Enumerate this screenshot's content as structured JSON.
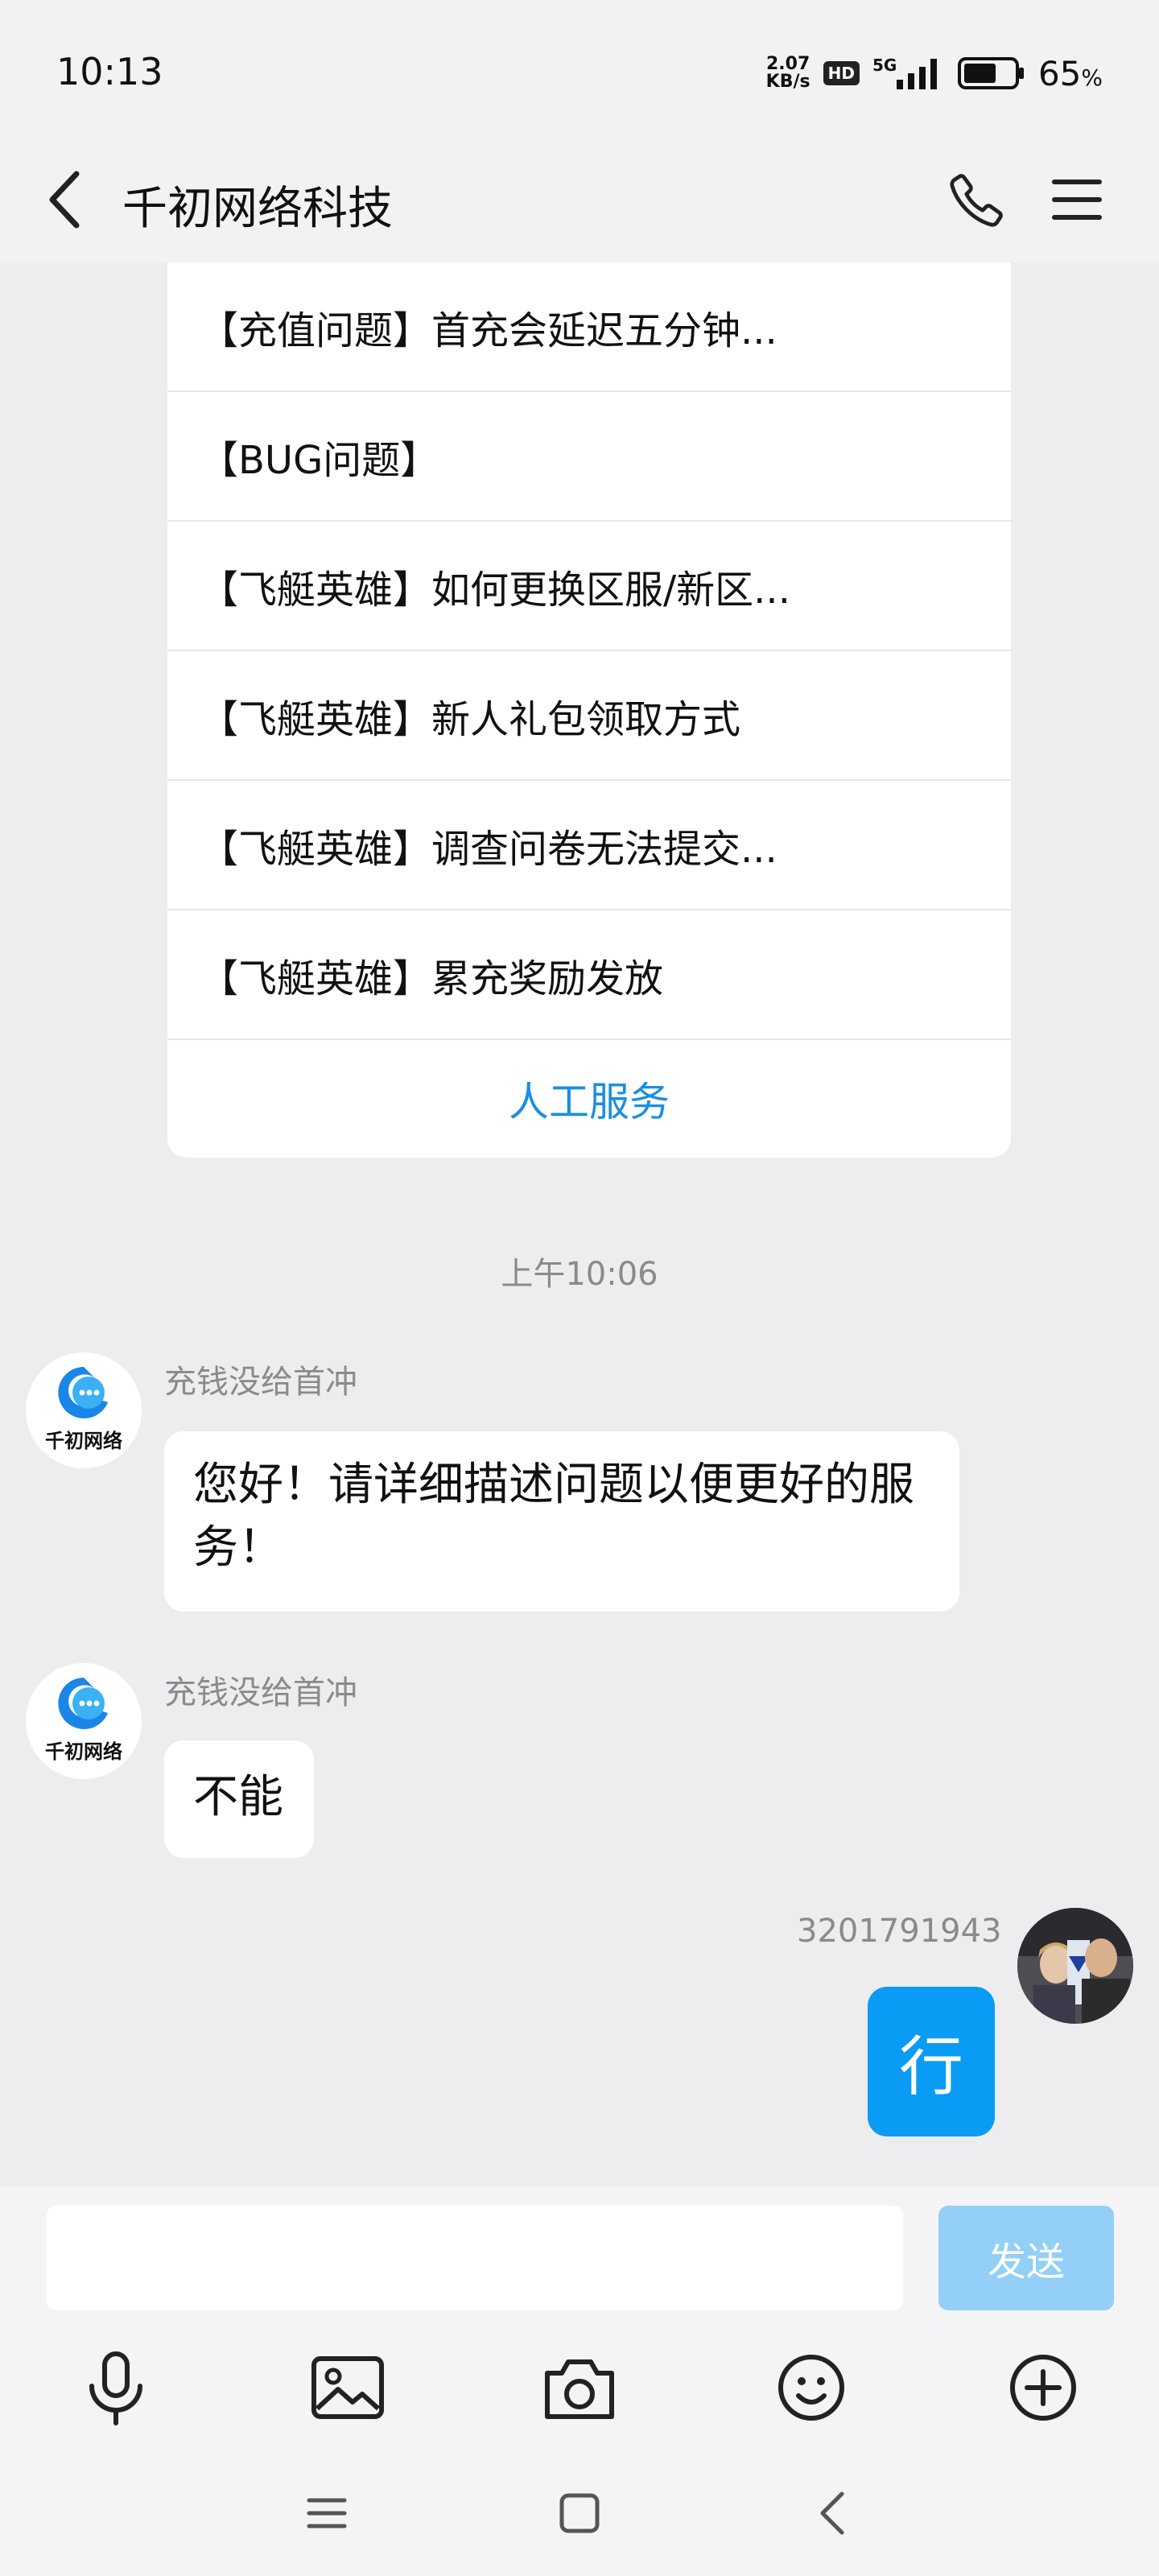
{
  "status_bar": {
    "time": "10:13",
    "net_speed_value": "2.07",
    "net_speed_unit": "KB/s",
    "hd_label": "HD",
    "network_label": "5G",
    "battery_percent": "65",
    "battery_percent_sign": "%",
    "battery_level": 0.65
  },
  "header": {
    "title": "千初网络科技",
    "back_icon": "back-arrow-icon",
    "call_icon": "phone-icon",
    "menu_icon": "menu-icon"
  },
  "faq": {
    "items": [
      "【充值问题】首充会延迟五分钟...",
      "【BUG问题】",
      "【飞艇英雄】如何更换区服/新区...",
      "【飞艇英雄】新人礼包领取方式",
      "【飞艇英雄】调查问卷无法提交...",
      "【飞艇英雄】累充奖励发放"
    ],
    "human_service": "人工服务"
  },
  "chat": {
    "timestamp": "上午10:06",
    "bot_avatar_text": "千初网络",
    "messages": [
      {
        "sender": "充钱没给首冲",
        "text": "您好！请详细描述问题以便更好的服务！"
      },
      {
        "sender": "充钱没给首冲",
        "text": "不能"
      },
      {
        "sender": "3201791943",
        "text": "行"
      }
    ]
  },
  "input": {
    "placeholder": "",
    "value": "",
    "send_label": "发送"
  },
  "toolbar": [
    "microphone-icon",
    "image-icon",
    "camera-icon",
    "emoji-icon",
    "plus-icon"
  ],
  "nav": [
    "nav-menu-icon",
    "nav-home-icon",
    "nav-back-icon"
  ],
  "colors": {
    "accent": "#0a9bf5",
    "send_disabled": "#93cff6",
    "link": "#1a8fe0",
    "background": "#ededf0"
  }
}
